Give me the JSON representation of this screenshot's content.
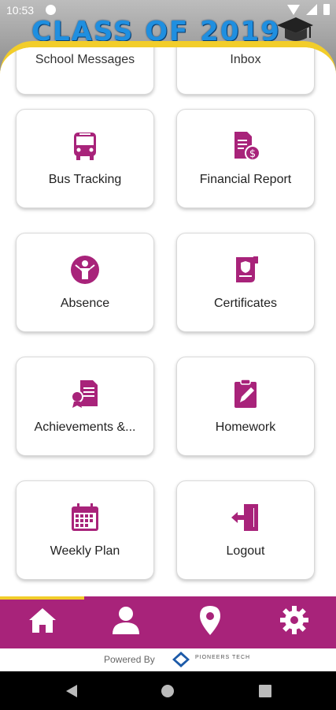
{
  "status_bar": {
    "time": "10:53"
  },
  "banner": {
    "text": "CLASS OF 2019"
  },
  "tiles": [
    {
      "label": "School Messages",
      "icon": "messages-icon"
    },
    {
      "label": "Inbox",
      "icon": "inbox-icon"
    },
    {
      "label": "Bus Tracking",
      "icon": "bus-icon"
    },
    {
      "label": "Financial Report",
      "icon": "financial-report-icon"
    },
    {
      "label": "Absence",
      "icon": "absence-icon"
    },
    {
      "label": "Certificates",
      "icon": "certificate-icon"
    },
    {
      "label": "Achievements &...",
      "icon": "achievements-icon"
    },
    {
      "label": "Homework",
      "icon": "homework-icon"
    },
    {
      "label": "Weekly Plan",
      "icon": "calendar-icon"
    },
    {
      "label": "Logout",
      "icon": "logout-icon"
    }
  ],
  "bottom_nav": [
    {
      "icon": "home-icon",
      "active": true
    },
    {
      "icon": "profile-icon",
      "active": false
    },
    {
      "icon": "location-icon",
      "active": false
    },
    {
      "icon": "settings-icon",
      "active": false
    }
  ],
  "footer": {
    "powered_by": "Powered By",
    "brand": "PIONEERS TECH"
  },
  "colors": {
    "accent": "#a8237a",
    "highlight": "#f2cd2a",
    "banner_text": "#1f8fe0"
  }
}
